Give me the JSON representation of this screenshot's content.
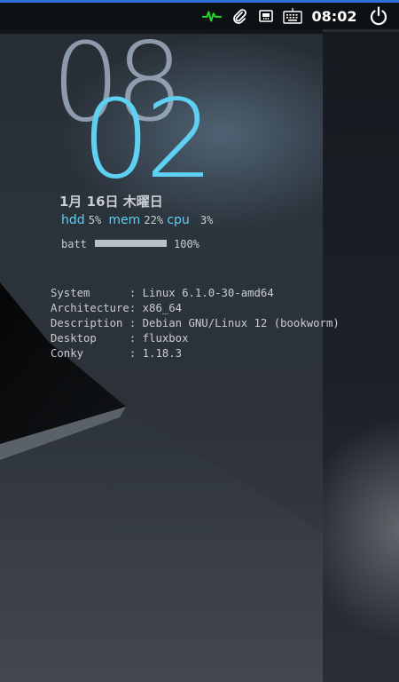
{
  "panel": {
    "accent_color": "#2f6fd6",
    "tray_icons": [
      "activity-monitor-icon",
      "paperclip-icon",
      "network-icon",
      "keyboard-icon"
    ],
    "clock": "08:02",
    "power_icon": "power-icon"
  },
  "conky": {
    "hours": "08",
    "minutes": "02",
    "date": "1月 16日 木曜日",
    "stats": {
      "hdd_label": "hdd",
      "hdd_value": "5%",
      "mem_label": "mem",
      "mem_value": "22%",
      "cpu_label": "cpu",
      "cpu_value": "3%"
    },
    "battery": {
      "label": "batt",
      "value": "100%",
      "level": 1.0
    },
    "sysinfo": [
      {
        "key": "System      ",
        "value": "Linux 6.1.0-30-amd64"
      },
      {
        "key": "Architecture",
        "value": "x86_64"
      },
      {
        "key": "Description ",
        "value": "Debian GNU/Linux 12 (bookworm)"
      },
      {
        "key": "Desktop     ",
        "value": "fluxbox"
      },
      {
        "key": "Conky       ",
        "value": "1.18.3"
      }
    ],
    "accent_color": "#5ed0f2"
  }
}
